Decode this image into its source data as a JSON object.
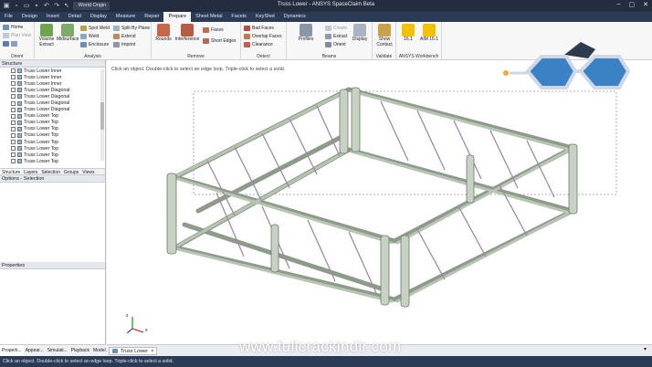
{
  "app": {
    "title": "Truss Lower - ANSYS SpaceClaim Beta",
    "qat_combo": "World Origin",
    "win_buttons": [
      "–",
      "▢",
      "✕"
    ]
  },
  "tabs": [
    "File",
    "Design",
    "Insert",
    "Detail",
    "Display",
    "Measure",
    "Repair",
    "Prepare",
    "Sheet Metal",
    "Facets",
    "KeyShot",
    "Dynamics"
  ],
  "active_tab": "Prepare",
  "ribbon": {
    "orient": {
      "label": "Orient",
      "home": "Home",
      "plan_view": "Plan View"
    },
    "analysis": {
      "label": "Analysis",
      "volume_extract": "Volume Extract",
      "midsurface": "Midsurface",
      "spot_weld": "Spot Weld",
      "weld": "Weld",
      "enclosure": "Enclosure",
      "split_by_plane": "Split By Plane",
      "extend": "Extend",
      "imprint": "Imprint"
    },
    "remove": {
      "label": "Remove",
      "rounds": "Rounds",
      "interference": "Interference",
      "faces": "Faces",
      "short_edges": "Short Edges"
    },
    "detect": {
      "label": "Detect",
      "bad_faces": "Bad Faces",
      "overlap_faces": "Overlap Faces",
      "clearance": "Clearance"
    },
    "beams": {
      "label": "Beams",
      "profiles": "Profiles",
      "create": "Create",
      "extract": "Extract",
      "orient": "Orient",
      "display": "Display"
    },
    "validate": {
      "label": "Validate",
      "show_contact": "Show Contact"
    },
    "workbench": {
      "label": "ANSYS Workbench",
      "v161": "16.1",
      "aim161": "AIM 16.1"
    }
  },
  "structure": {
    "header": "Structure",
    "items": [
      "Truss Lower Inner",
      "Truss Lower Inner",
      "Truss Lower Inner",
      "Truss Lower Diagonal",
      "Truss Lower Diagonal",
      "Truss Lower Diagonal",
      "Truss Lower Diagonal",
      "Truss Lower Top",
      "Truss Lower Top",
      "Truss Lower Top",
      "Truss Lower Top",
      "Truss Lower Top",
      "Truss Lower Top",
      "Truss Lower Top",
      "Truss Lower Top"
    ],
    "subtabs": [
      "Structure",
      "Layers",
      "Selection",
      "Groups",
      "Views"
    ]
  },
  "options_header": "Options - Selection",
  "properties_header": "Properties",
  "bottom_tabs": [
    "Properti...",
    "Appear...",
    "Simulati...",
    "Playback",
    "Model..."
  ],
  "viewport_hint": "Click an object. Double-click to select an edge loop. Triple-click to select a solid.",
  "doc_tab": "Truss Lower",
  "status": "Click an object. Double-click to select an edge loop. Triple-click to select a solid.",
  "watermark": "www.fullcrackindir.com",
  "triad_axis": [
    "z",
    "x"
  ],
  "colors": {
    "accent": "#2b3a55",
    "active_tab": "#f5f6f8",
    "model": "#c8d2c4"
  }
}
